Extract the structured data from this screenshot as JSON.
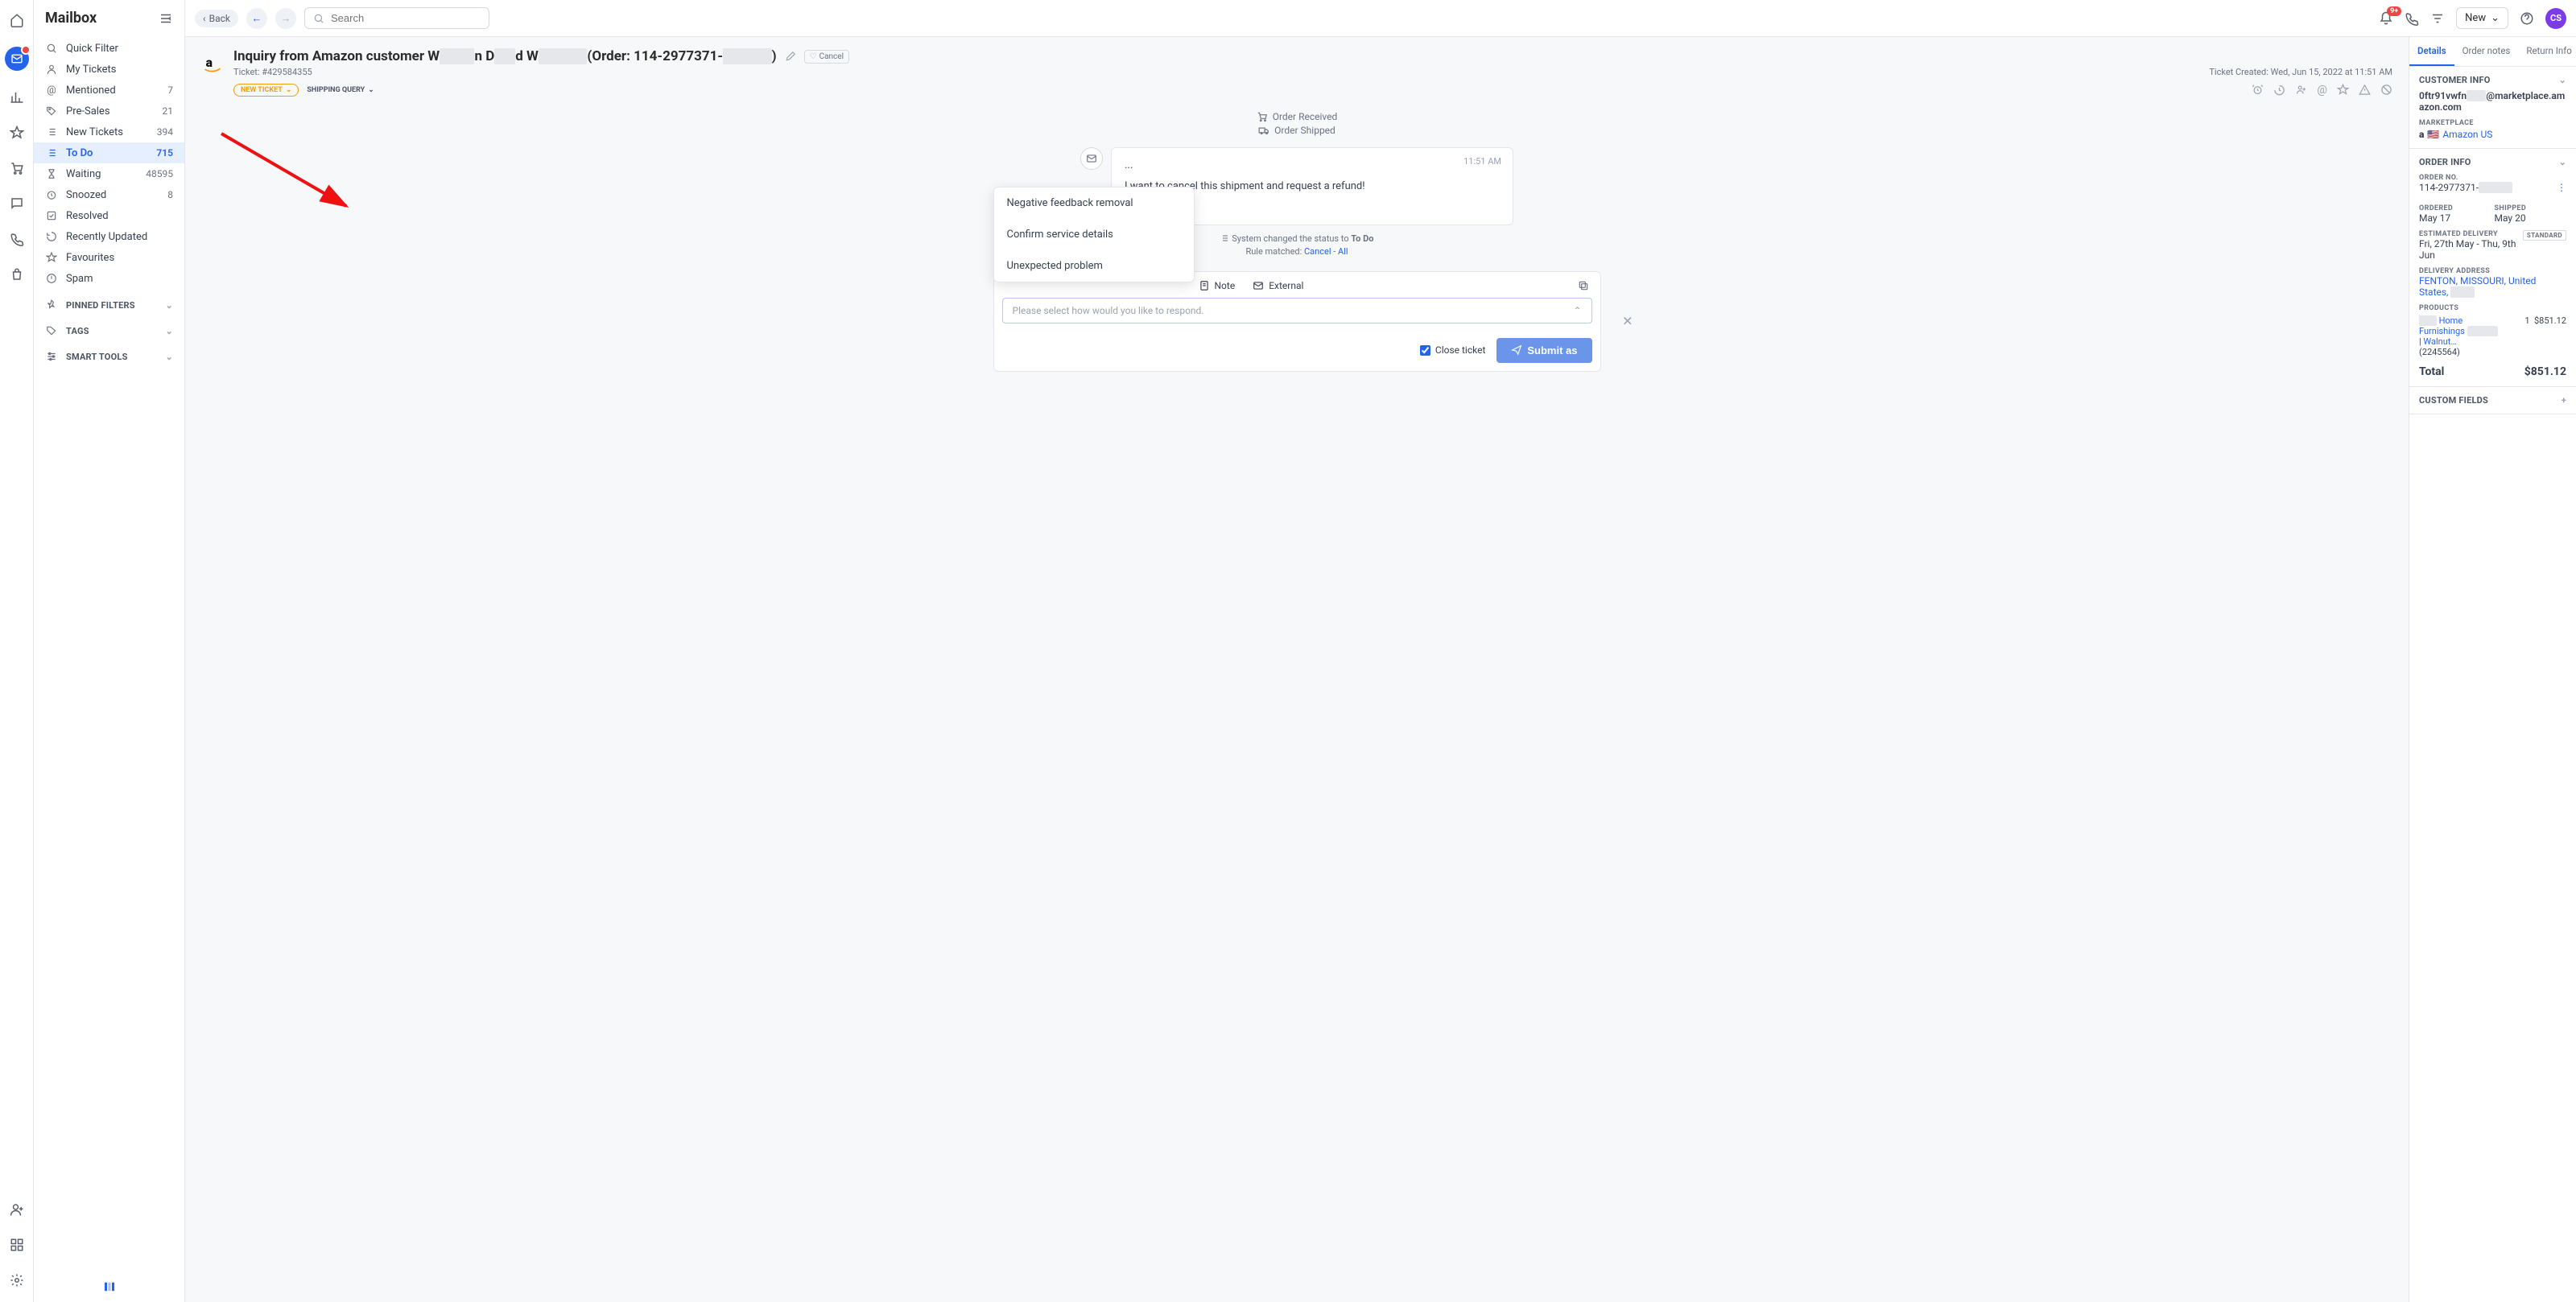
{
  "rail": {
    "notif_badge": "9+",
    "avatar_initials": "CS"
  },
  "sidebar": {
    "title": "Mailbox",
    "items": [
      {
        "icon": "search",
        "label": "Quick Filter",
        "count": ""
      },
      {
        "icon": "user",
        "label": "My Tickets",
        "count": ""
      },
      {
        "icon": "at",
        "label": "Mentioned",
        "count": "7"
      },
      {
        "icon": "tag",
        "label": "Pre-Sales",
        "count": "21"
      },
      {
        "icon": "list",
        "label": "New Tickets",
        "count": "394"
      },
      {
        "icon": "list",
        "label": "To Do",
        "count": "715",
        "active": true
      },
      {
        "icon": "hourglass",
        "label": "Waiting",
        "count": "48595"
      },
      {
        "icon": "snooze",
        "label": "Snoozed",
        "count": "8"
      },
      {
        "icon": "check",
        "label": "Resolved",
        "count": ""
      },
      {
        "icon": "clock",
        "label": "Recently Updated",
        "count": ""
      },
      {
        "icon": "star",
        "label": "Favourites",
        "count": ""
      },
      {
        "icon": "spam",
        "label": "Spam",
        "count": ""
      }
    ],
    "sections": [
      {
        "label": "PINNED FILTERS"
      },
      {
        "label": "TAGS"
      },
      {
        "label": "SMART TOOLS"
      }
    ]
  },
  "topbar": {
    "back": "Back",
    "search_placeholder": "Search",
    "new_label": "New",
    "notif_badge": "9+",
    "avatar_initials": "CS"
  },
  "ticket": {
    "title_pre": "Inquiry from Amazon customer W",
    "title_mid1": "n D",
    "title_mid2": "d W",
    "title_order": "(Order: 114-2977371-",
    "title_close": ")",
    "cancel_tag": "Cancel",
    "ticket_id": "Ticket: #429584355",
    "created": "Ticket Created: Wed, Jun 15, 2022 at 11:51 AM",
    "status_pill": "NEW TICKET",
    "shipping_query": "SHIPPING QUERY",
    "events": [
      {
        "icon": "cart",
        "label": "Order Received"
      },
      {
        "icon": "truck",
        "label": "Order Shipped"
      }
    ],
    "message": {
      "time": "11:51 AM",
      "dots": "...",
      "body": "I want to cancel this shipment and request a refund!"
    },
    "sys": {
      "prefix": "System changed the status to ",
      "status": "To Do",
      "rule_prefix": "Rule matched: ",
      "rule1": "Cancel",
      "rule_sep": " - ",
      "rule2": "All"
    },
    "popup": [
      "Negative feedback removal",
      "Confirm service details",
      "Unexpected problem"
    ],
    "reply": {
      "tabs": [
        {
          "icon": "note",
          "label": "Note"
        },
        {
          "icon": "mail",
          "label": "External"
        }
      ],
      "placeholder": "Please select how would you like to respond.",
      "close_ticket": "Close ticket",
      "submit": "Submit as"
    }
  },
  "right": {
    "tabs": [
      "Details",
      "Order notes",
      "Return Info"
    ],
    "customer": {
      "head": "CUSTOMER INFO",
      "email_pre": "0ftr91vwfn",
      "email_post": "@marketplace.amazon.com",
      "marketplace_label": "MARKETPLACE",
      "marketplace": "Amazon US"
    },
    "order": {
      "head": "ORDER INFO",
      "order_no_label": "ORDER NO.",
      "order_no": "114-2977371-",
      "ordered_label": "ORDERED",
      "ordered": "May 17",
      "shipped_label": "SHIPPED",
      "shipped": "May 20",
      "est_label": "ESTIMATED DELIVERY",
      "est": "Fri, 27th May - Thu, 9th Jun",
      "std_badge": "STANDARD",
      "addr_label": "DELIVERY ADDRESS",
      "addr": "FENTON, MISSOURI, United States,",
      "products_label": "PRODUCTS",
      "product_name_pre": "Home Furnishings",
      "product_name_mid": " | ",
      "product_name_post": "Walnut…",
      "product_sku": "(2245564)",
      "product_qty": "1",
      "product_price": "$851.12",
      "total_label": "Total",
      "total": "$851.12"
    },
    "custom": {
      "head": "CUSTOM FIELDS"
    }
  }
}
